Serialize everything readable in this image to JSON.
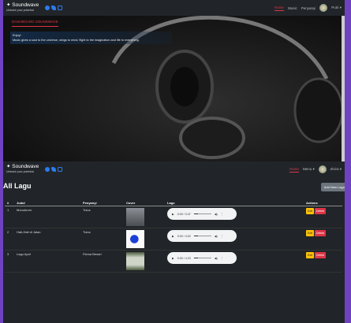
{
  "top": {
    "brand": "Soundwave",
    "tagline": "Unleash your potential",
    "nav": [
      "Home",
      "Music",
      "Penyanyi"
    ],
    "user": "Putri",
    "dash_title": "DASHBOARD SOUNDWAVE",
    "enjoy": "Enjoy!",
    "quote": "Music gives a soul to the universe, wings to mind, flight to the imagination and life to everything."
  },
  "bottom": {
    "brand": "Soundwave",
    "tagline": "Unleash your potential",
    "nav": [
      "Home",
      "Menu"
    ],
    "user": "elvira",
    "page_title": "All Lagu",
    "add_button": "Add New Lagu",
    "columns": [
      "#",
      "Judul",
      "Penyanyi",
      "Cover",
      "Lagu",
      "Actions"
    ],
    "rows": [
      {
        "no": "1",
        "judul": "Monokrom",
        "penyanyi": "Tulus",
        "time": "0:00 / 3:47",
        "edit": "Edit",
        "delete": "Delete"
      },
      {
        "no": "2",
        "judul": "Hati-Hati di Jalan",
        "penyanyi": "Tulus",
        "time": "0:00 / 4:02",
        "edit": "Edit",
        "delete": "Delete"
      },
      {
        "no": "3",
        "judul": "Lagu April",
        "penyanyi": "Fiersa Besari",
        "time": "0:00 / 4:23",
        "edit": "Edit",
        "delete": "Delete"
      }
    ]
  },
  "colors": {
    "accent": "#dc3545",
    "frame": "#6f42c1",
    "edit": "#ffc107"
  }
}
